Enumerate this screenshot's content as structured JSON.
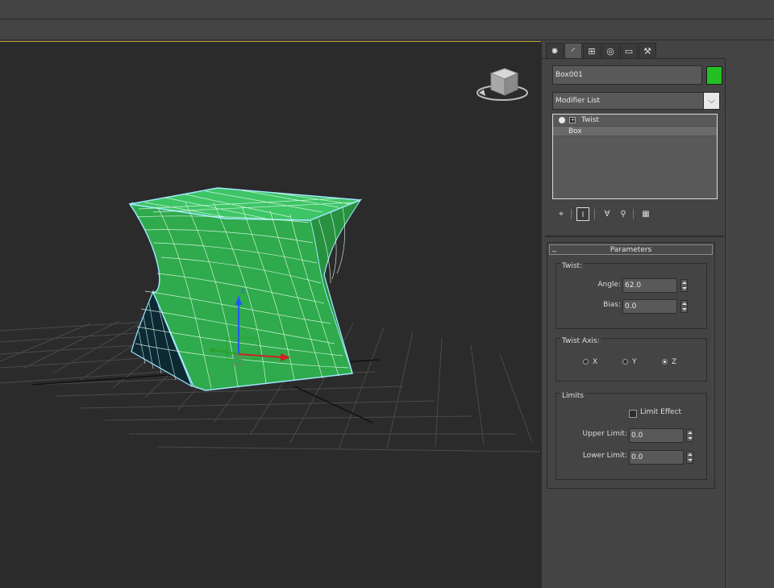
{
  "object": {
    "name": "Box001",
    "color": "#22c022"
  },
  "modifier_list": {
    "label": "Modifier List",
    "dropdown_icon": "chevron-down-icon"
  },
  "stack": {
    "items": [
      {
        "label": "Twist",
        "selected": true
      },
      {
        "label": "Box",
        "selected": false
      }
    ]
  },
  "command_tabs": [
    {
      "name": "create",
      "icon": "sun-icon"
    },
    {
      "name": "modify",
      "icon": "modify-arc-icon",
      "active": true
    },
    {
      "name": "hierarchy",
      "icon": "hierarchy-icon"
    },
    {
      "name": "motion",
      "icon": "motion-circle-icon"
    },
    {
      "name": "display",
      "icon": "monitor-icon"
    },
    {
      "name": "utilities",
      "icon": "hammer-icon"
    }
  ],
  "parameters": {
    "title": "Parameters",
    "twist": {
      "group_title": "Twist:",
      "angle_label": "Angle:",
      "angle_value": "62.0",
      "bias_label": "Bias:",
      "bias_value": "0.0"
    },
    "twist_axis": {
      "group_title": "Twist Axis:",
      "options": [
        "X",
        "Y",
        "Z"
      ],
      "selected": "Z"
    },
    "limits": {
      "group_title": "Limits",
      "limit_effect_label": "Limit Effect",
      "limit_effect_checked": false,
      "upper_label": "Upper Limit:",
      "upper_value": "0.0",
      "lower_label": "Lower Limit:",
      "lower_value": "0.0"
    }
  },
  "viewport": {
    "object_color": "#2fb84f",
    "selection_color": "#9fe8ff",
    "gizmo_colors": {
      "x": "#d02020",
      "y": "#2aa02a",
      "z": "#2255ff"
    }
  }
}
